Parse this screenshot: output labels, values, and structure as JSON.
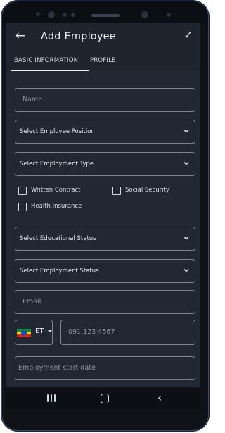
{
  "appbar": {
    "title": "Add Employee",
    "back_icon": "arrow-left-icon",
    "save_icon": "check-icon"
  },
  "tabs": [
    {
      "label": "BASIC INFORMATION",
      "active": true
    },
    {
      "label": "PROFILE",
      "active": false
    }
  ],
  "form": {
    "name_placeholder": "Name",
    "position_select": "Select Employee Position",
    "employment_type_select": "Select Employment Type",
    "checkboxes": [
      {
        "label": "Written Contract",
        "checked": false
      },
      {
        "label": "Social Security",
        "checked": false
      },
      {
        "label": "Health Insurance",
        "checked": false
      }
    ],
    "educational_status_select": "Select Educational Status",
    "employment_status_select": "Select Employment Status",
    "email_placeholder": "Email",
    "country_code": "ET",
    "phone_placeholder": "091 123 4567",
    "start_date_placeholder": "Employment start date"
  },
  "colors": {
    "background": "#212833",
    "appbar": "#1f252e",
    "border": "#7a8493",
    "text": "#e5e9ef"
  }
}
